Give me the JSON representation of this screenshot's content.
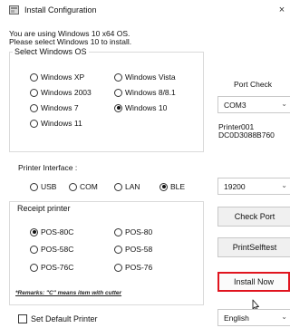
{
  "window": {
    "title": "Install Configuration",
    "close_glyph": "×"
  },
  "info": {
    "line1": "You are using Windows 10 x64 OS.",
    "line2": "Please select Windows 10 to install."
  },
  "windows_os": {
    "title": "Select Windows OS",
    "options": [
      {
        "label": "Windows XP",
        "selected": false
      },
      {
        "label": "Windows Vista",
        "selected": false
      },
      {
        "label": "Windows 2003",
        "selected": false
      },
      {
        "label": "Windows 8/8.1",
        "selected": false
      },
      {
        "label": "Windows 7",
        "selected": false
      },
      {
        "label": "Windows 10",
        "selected": true
      },
      {
        "label": "Windows 11",
        "selected": false
      }
    ]
  },
  "port_check": {
    "title": "Port Check",
    "port_value": "COM3",
    "printer_name": "Printer001",
    "printer_id": "DC0D3088B760"
  },
  "printer_interface": {
    "title": "Printer Interface :",
    "options": [
      {
        "label": "USB",
        "selected": false
      },
      {
        "label": "COM",
        "selected": false
      },
      {
        "label": "LAN",
        "selected": false
      },
      {
        "label": "BLE",
        "selected": true
      }
    ],
    "baud_value": "19200"
  },
  "receipt_printer": {
    "title": "Receipt printer",
    "options": [
      {
        "label": "POS-80C",
        "selected": true
      },
      {
        "label": "POS-80",
        "selected": false
      },
      {
        "label": "POS-58C",
        "selected": false
      },
      {
        "label": "POS-58",
        "selected": false
      },
      {
        "label": "POS-76C",
        "selected": false
      },
      {
        "label": "POS-76",
        "selected": false
      }
    ],
    "remarks": "*Remarks: \"C\" means item with cutter"
  },
  "buttons": {
    "check_port": "Check Port",
    "print_selftest": "PrintSelftest",
    "install_now": "Install Now"
  },
  "footer": {
    "set_default_label": "Set Default Printer",
    "set_default_checked": false,
    "language_value": "English"
  },
  "colors": {
    "highlight_border": "#e0141e",
    "button_bg": "#f0f0f0"
  },
  "icons": {
    "chevron": "chevron-down-icon",
    "app": "app-config-icon",
    "cursor": "mouse-pointer-icon"
  }
}
